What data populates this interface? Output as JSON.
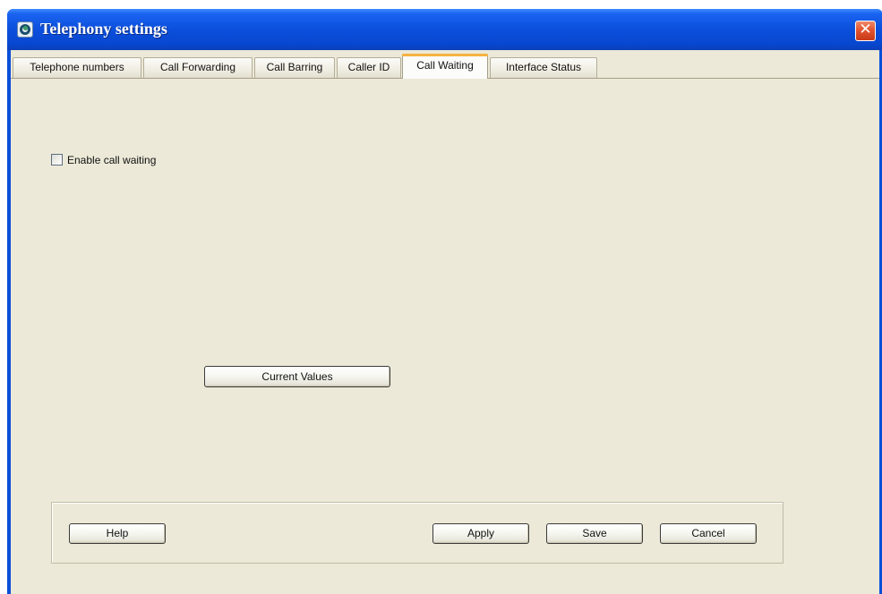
{
  "window": {
    "title": "Telephony settings",
    "icon": "telephony-app-icon",
    "close_icon": "close-x-icon",
    "close_glyph": "✕"
  },
  "tabs": [
    {
      "label": "Telephone numbers",
      "active": false
    },
    {
      "label": "Call Forwarding",
      "active": false
    },
    {
      "label": "Call Barring",
      "active": false
    },
    {
      "label": "Caller ID",
      "active": false
    },
    {
      "label": "Call Waiting",
      "active": true
    },
    {
      "label": "Interface Status",
      "active": false
    }
  ],
  "call_waiting": {
    "enable_label": "Enable call waiting",
    "enable_checked": false,
    "current_values_label": "Current Values"
  },
  "buttons": {
    "help": "Help",
    "apply": "Apply",
    "save": "Save",
    "cancel": "Cancel"
  },
  "colors": {
    "titlebar": "#0b4fdc",
    "client_bg": "#ece9d8",
    "active_tab_accent": "#f5b341",
    "close_button": "#e2552f"
  }
}
